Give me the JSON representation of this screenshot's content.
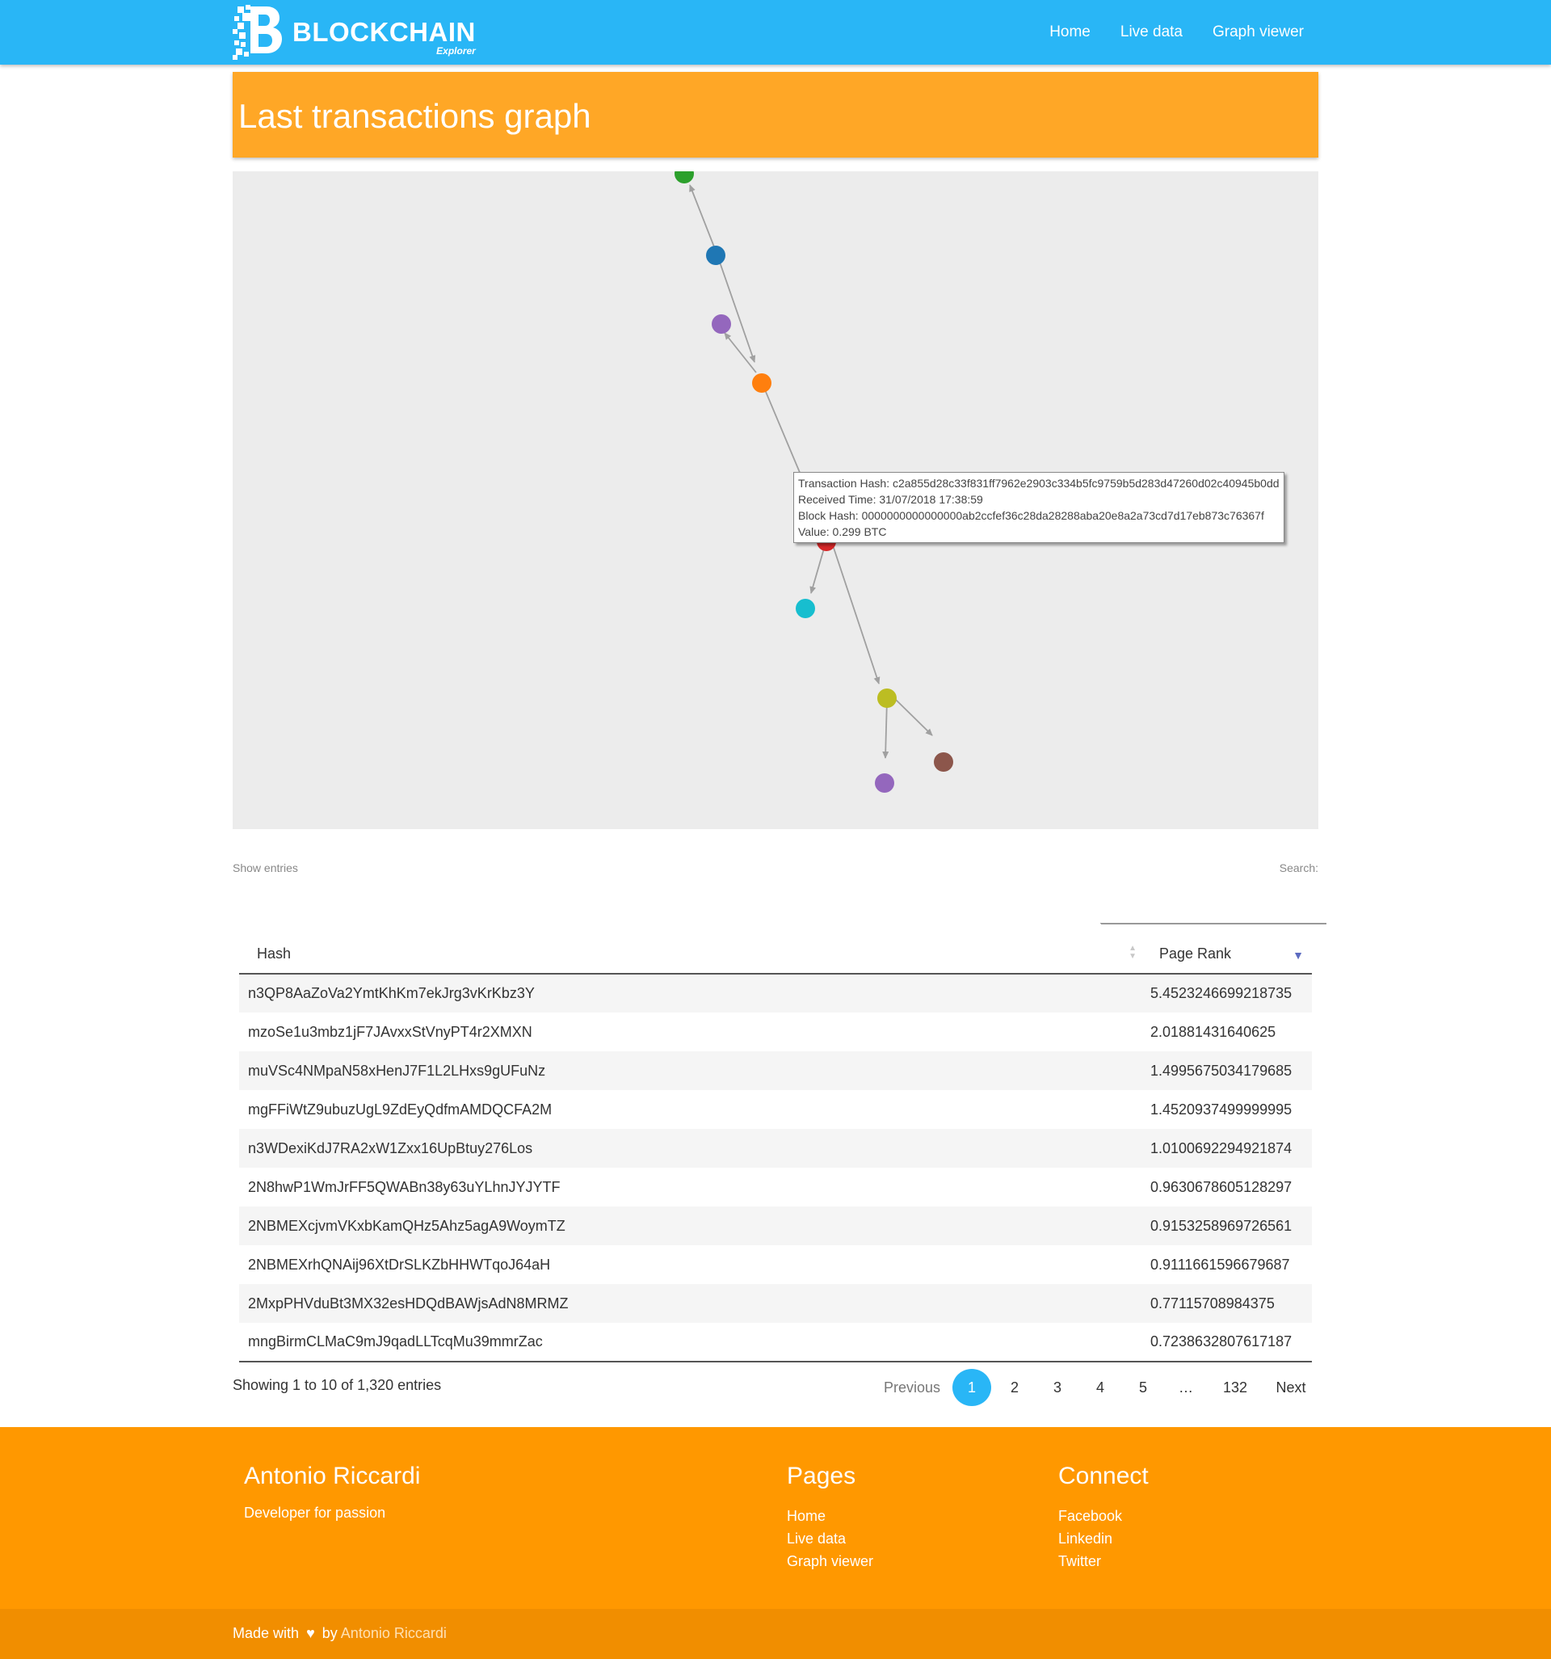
{
  "brand": {
    "title": "BLOCKCHAIN",
    "subtitle": "Explorer"
  },
  "nav": {
    "home": "Home",
    "live": "Live data",
    "graph": "Graph viewer"
  },
  "page_title": "Last transactions graph",
  "graph": {
    "node_colors": [
      "#2ca02c",
      "#1f77b4",
      "#9467bd",
      "#ff7f0e",
      "#d62728",
      "#17becf",
      "#bcbd22",
      "#8c564b",
      "#9467bd"
    ],
    "edge_color": "#a0a0a0"
  },
  "tooltip": {
    "line1": "Transaction Hash: c2a855d28c33f831ff7962e2903c334b5fc9759b5d283d47260d02c40945b0dd",
    "line2": "Received Time: 31/07/2018 17:38:59",
    "line3": "Block Hash: 0000000000000000ab2ccfef36c28da28288aba20e8a2a73cd7d17eb873c76367f",
    "line4": "Value: 0.299 BTC"
  },
  "controls": {
    "show_entries": "Show entries",
    "search": "Search:"
  },
  "table": {
    "headers": {
      "hash": "Hash",
      "rank": "Page Rank"
    },
    "rows": [
      {
        "hash": "n3QP8AaZoVa2YmtKhKm7ekJrg3vKrKbz3Y",
        "rank": "5.4523246699218735"
      },
      {
        "hash": "mzoSe1u3mbz1jF7JAvxxStVnyPT4r2XMXN",
        "rank": "2.01881431640625"
      },
      {
        "hash": "muVSc4NMpaN58xHenJ7F1L2LHxs9gUFuNz",
        "rank": "1.4995675034179685"
      },
      {
        "hash": "mgFFiWtZ9ubuzUgL9ZdEyQdfmAMDQCFA2M",
        "rank": "1.4520937499999995"
      },
      {
        "hash": "n3WDexiKdJ7RA2xW1Zxx16UpBtuy276Los",
        "rank": "1.0100692294921874"
      },
      {
        "hash": "2N8hwP1WmJrFF5QWABn38y63uYLhnJYJYTF",
        "rank": "0.9630678605128297"
      },
      {
        "hash": "2NBMEXcjvmVKxbKamQHz5Ahz5agA9WoymTZ",
        "rank": "0.9153258969726561"
      },
      {
        "hash": "2NBMEXrhQNAij96XtDrSLKZbHHWTqoJ64aH",
        "rank": "0.9111661596679687"
      },
      {
        "hash": "2MxpPHVduBt3MX32esHDQdBAWjsAdN8MRMZ",
        "rank": "0.77115708984375"
      },
      {
        "hash": "mngBirmCLMaC9mJ9qadLLTcqMu39mmrZac",
        "rank": "0.7238632807617187"
      }
    ]
  },
  "info": "Showing 1 to 10 of 1,320 entries",
  "pagination": {
    "previous": "Previous",
    "p1": "1",
    "p2": "2",
    "p3": "3",
    "p4": "4",
    "p5": "5",
    "ellipsis": "…",
    "last": "132",
    "next": "Next"
  },
  "footer": {
    "name": "Antonio Riccardi",
    "tagline": "Developer for passion",
    "pages_title": "Pages",
    "pages": {
      "home": "Home",
      "live": "Live data",
      "graph": "Graph viewer"
    },
    "connect_title": "Connect",
    "connect": {
      "facebook": "Facebook",
      "linkedin": "Linkedin",
      "twitter": "Twitter"
    },
    "made_with": "Made with",
    "by": "by",
    "author": "Antonio Riccardi"
  }
}
